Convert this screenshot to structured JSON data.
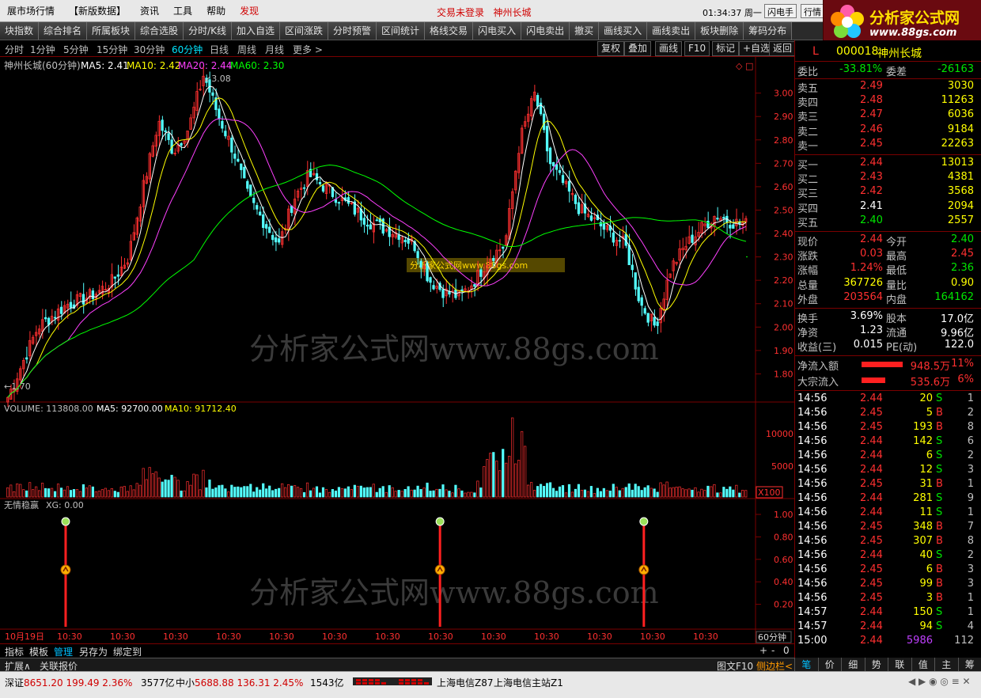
{
  "menu": {
    "items": [
      "展市场行情",
      "【新版数据】",
      "资讯",
      "工具",
      "帮助",
      "发现"
    ],
    "login_status": "交易未登录",
    "stock_title": "神州长城",
    "clock": "01:34:37 周一",
    "btn_flash": "闪电手",
    "btn_quote": "行情"
  },
  "logo": {
    "title": "分析家公式网",
    "url": "www.88gs.com"
  },
  "toolbar": [
    "块指数",
    "综合排名",
    "所属板块",
    "综合选股",
    "分时/K线",
    "加入自选",
    "区间涨跌",
    "分时预警",
    "区间统计",
    "格线交易",
    "闪电买入",
    "闪电卖出",
    "撤买",
    "画线买入",
    "画线卖出",
    "板块删除",
    "筹码分布"
  ],
  "periods": [
    "分时",
    "1分钟",
    "5分钟",
    "15分钟",
    "30分钟",
    "60分钟",
    "日线",
    "周线",
    "月线",
    "更多 >"
  ],
  "period_active": "60分钟",
  "chart_buttons": [
    "复权",
    "叠加",
    "画线",
    "F10",
    "标记",
    "+自选",
    "返回"
  ],
  "main_legend": {
    "name": "神州长城(60分钟)",
    "ma5": "MA5: 2.41",
    "ma10": "MA10: 2.42",
    "ma20": "MA20: 2.44",
    "ma60": "MA60: 2.30"
  },
  "high_label": "3.08",
  "low_label": "1.70",
  "watermark_main": "分析家公式网www.88gs.com",
  "watermark_small": "分析家公式网www.88gs.com",
  "price_axis": [
    "3.00",
    "2.90",
    "2.80",
    "2.70",
    "2.60",
    "2.50",
    "2.40",
    "2.30",
    "2.20",
    "2.10",
    "2.00",
    "1.90",
    "1.80"
  ],
  "volume_legend": {
    "label": "VOLUME: 113808.00",
    "ma5": "MA5: 92700.00",
    "ma10": "MA10: 91712.40"
  },
  "volume_axis": [
    "10000",
    "5000"
  ],
  "volume_unit": "X100",
  "indicator_legend": {
    "name": "无情稳赢",
    "xg": "XG: 0.00"
  },
  "indicator_axis": [
    "1.00",
    "0.80",
    "0.60",
    "0.40",
    "0.20"
  ],
  "date_axis": [
    "10月19日",
    "10:30",
    "10:30",
    "10:30",
    "10:30",
    "10:30",
    "10:30",
    "10:30",
    "10:30",
    "10:30",
    "10:30",
    "10:30",
    "10:30",
    "10:30"
  ],
  "period_label": "60分钟",
  "bottom_tabs": [
    "指标",
    "模板",
    "管理",
    "另存为",
    "绑定到"
  ],
  "bottom_tabs2": [
    "扩展∧",
    "关联报价"
  ],
  "bottom_right": [
    "图文F10",
    "侧边栏<"
  ],
  "right_tabs": [
    "笔",
    "价",
    "细",
    "势",
    "联",
    "值",
    "主",
    "筹"
  ],
  "quote": {
    "l_mark": "L",
    "code": "000018",
    "name": "神州长城",
    "weibi_label": "委比",
    "weibi": "-33.81%",
    "weicha_label": "委差",
    "weicha": "-26163",
    "asks": [
      {
        "label": "卖五",
        "price": "2.49",
        "vol": "3030"
      },
      {
        "label": "卖四",
        "price": "2.48",
        "vol": "11263"
      },
      {
        "label": "卖三",
        "price": "2.47",
        "vol": "6036"
      },
      {
        "label": "卖二",
        "price": "2.46",
        "vol": "9184"
      },
      {
        "label": "卖一",
        "price": "2.45",
        "vol": "22263"
      }
    ],
    "bids": [
      {
        "label": "买一",
        "price": "2.44",
        "vol": "13013"
      },
      {
        "label": "买二",
        "price": "2.43",
        "vol": "4381"
      },
      {
        "label": "买三",
        "price": "2.42",
        "vol": "3568"
      },
      {
        "label": "买四",
        "price": "2.41",
        "vol": "2094"
      },
      {
        "label": "买五",
        "price": "2.40",
        "vol": "2557"
      }
    ],
    "stats": [
      {
        "l1": "现价",
        "v1": "2.44",
        "l2": "今开",
        "v2": "2.40"
      },
      {
        "l1": "涨跌",
        "v1": "0.03",
        "l2": "最高",
        "v2": "2.45"
      },
      {
        "l1": "涨幅",
        "v1": "1.24%",
        "l2": "最低",
        "v2": "2.36"
      },
      {
        "l1": "总量",
        "v1": "367726",
        "l2": "量比",
        "v2": "0.90"
      },
      {
        "l1": "外盘",
        "v1": "203564",
        "l2": "内盘",
        "v2": "164162"
      }
    ],
    "stats2": [
      {
        "l1": "换手",
        "v1": "3.69%",
        "l2": "股本",
        "v2": "17.0亿"
      },
      {
        "l1": "净资",
        "v1": "1.23",
        "l2": "流通",
        "v2": "9.96亿"
      },
      {
        "l1": "收益(三)",
        "v1": "0.015",
        "l2": "PE(动)",
        "v2": "122.0"
      }
    ],
    "flow": [
      {
        "label": "净流入额",
        "value": "948.5万",
        "pct": "11%"
      },
      {
        "label": "大宗流入",
        "value": "535.6万",
        "pct": "6%"
      }
    ],
    "ticks": [
      {
        "t": "14:56",
        "p": "2.44",
        "v": "20",
        "d": "S",
        "n": "1"
      },
      {
        "t": "14:56",
        "p": "2.45",
        "v": "5",
        "d": "B",
        "n": "2"
      },
      {
        "t": "14:56",
        "p": "2.45",
        "v": "193",
        "d": "B",
        "n": "8"
      },
      {
        "t": "14:56",
        "p": "2.44",
        "v": "142",
        "d": "S",
        "n": "6"
      },
      {
        "t": "14:56",
        "p": "2.44",
        "v": "6",
        "d": "S",
        "n": "2"
      },
      {
        "t": "14:56",
        "p": "2.44",
        "v": "12",
        "d": "S",
        "n": "3"
      },
      {
        "t": "14:56",
        "p": "2.45",
        "v": "31",
        "d": "B",
        "n": "1"
      },
      {
        "t": "14:56",
        "p": "2.44",
        "v": "281",
        "d": "S",
        "n": "9"
      },
      {
        "t": "14:56",
        "p": "2.44",
        "v": "11",
        "d": "S",
        "n": "1"
      },
      {
        "t": "14:56",
        "p": "2.45",
        "v": "348",
        "d": "B",
        "n": "7"
      },
      {
        "t": "14:56",
        "p": "2.45",
        "v": "307",
        "d": "B",
        "n": "8"
      },
      {
        "t": "14:56",
        "p": "2.44",
        "v": "40",
        "d": "S",
        "n": "2"
      },
      {
        "t": "14:56",
        "p": "2.45",
        "v": "6",
        "d": "B",
        "n": "3"
      },
      {
        "t": "14:56",
        "p": "2.45",
        "v": "99",
        "d": "B",
        "n": "3"
      },
      {
        "t": "14:56",
        "p": "2.45",
        "v": "3",
        "d": "B",
        "n": "1"
      },
      {
        "t": "14:57",
        "p": "2.44",
        "v": "150",
        "d": "S",
        "n": "1"
      },
      {
        "t": "14:57",
        "p": "2.44",
        "v": "94",
        "d": "S",
        "n": "4"
      },
      {
        "t": "15:00",
        "p": "2.44",
        "v": "5986",
        "d": "",
        "n": "112"
      }
    ]
  },
  "status": {
    "sz_label": "深证",
    "sz_value": "8651.20",
    "sz_change": "199.49",
    "sz_pct": "2.36%",
    "sz_amount": "3577亿",
    "zx_label": "中小",
    "zx_value": "5688.88",
    "zx_change": "136.31",
    "zx_pct": "2.45%",
    "zx_amount": "1543亿",
    "server1": "上海电信Z87",
    "server2": "上海电信主站Z1"
  },
  "colors": {
    "ma5": "#ffffff",
    "ma10": "#ffff00",
    "ma20": "#ff40ff",
    "ma60": "#00ff00",
    "up": "#ff3030",
    "down": "#54ffff"
  },
  "chart_data": {
    "type": "candlestick",
    "interval": "60分钟",
    "y_range": [
      1.7,
      3.08
    ],
    "ohlc_shape": [
      1.7,
      1.85,
      2.0,
      2.05,
      2.1,
      2.12,
      2.15,
      2.2,
      2.3,
      2.6,
      2.88,
      2.75,
      2.85,
      3.08,
      2.9,
      2.75,
      2.55,
      2.45,
      2.35,
      2.55,
      2.65,
      2.6,
      2.55,
      2.5,
      2.45,
      2.42,
      2.4,
      2.35,
      2.2,
      2.15,
      2.13,
      2.2,
      2.3,
      2.35,
      2.8,
      3.0,
      2.7,
      2.6,
      2.5,
      2.45,
      2.4,
      2.35,
      2.1,
      2.0,
      2.25,
      2.35,
      2.42,
      2.48,
      2.45,
      2.44
    ],
    "indicator_signals": [
      0.08,
      0.585,
      0.86
    ]
  }
}
